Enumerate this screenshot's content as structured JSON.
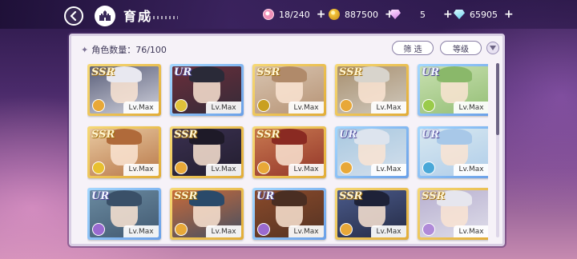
{
  "header": {
    "title": "育成",
    "resources": [
      {
        "icon": "candy-icon",
        "value": "18/240"
      },
      {
        "icon": "coin-icon",
        "value": "887500"
      },
      {
        "icon": "pink-gem-icon",
        "value": "5"
      },
      {
        "icon": "blue-gem-icon",
        "value": "65905"
      }
    ],
    "plus": "+"
  },
  "panel": {
    "count_label": "角色数量：76/100",
    "filter_button": "筛 选",
    "level_button": "等级"
  },
  "cards": [
    {
      "rarity": "SSR",
      "level": "Lv.Max",
      "hair": "#e8e8f0",
      "bg": "#5a5f7a",
      "attr": "#e8a838"
    },
    {
      "rarity": "UR",
      "level": "Lv.Max",
      "hair": "#2a2a38",
      "bg": "#6a2e3a",
      "attr": "#e0c23a"
    },
    {
      "rarity": "SSR",
      "level": "Lv.Max",
      "hair": "#b08a6a",
      "bg": "#d8c4b0",
      "attr": "#c9a020"
    },
    {
      "rarity": "SSR",
      "level": "Lv.Max",
      "hair": "#d8d4cc",
      "bg": "#a89070",
      "attr": "#e8a838"
    },
    {
      "rarity": "UR",
      "level": "Lv.Max",
      "hair": "#8ab86a",
      "bg": "#c8e0b0",
      "attr": "#9acb4a"
    },
    {
      "rarity": "SSR",
      "level": "Lv.Max",
      "hair": "#b06a3a",
      "bg": "#e8c8a0",
      "attr": "#e8c030"
    },
    {
      "rarity": "SSR",
      "level": "Lv.Max",
      "hair": "#1e1a28",
      "bg": "#3a3050",
      "attr": "#e8a838"
    },
    {
      "rarity": "SSR",
      "level": "Lv.Max",
      "hair": "#8a2a22",
      "bg": "#c87850",
      "attr": "#e8a838"
    },
    {
      "rarity": "UR",
      "level": "Lv.Max",
      "hair": "#dde4ee",
      "bg": "#a8c8e0",
      "attr": "#e8a838"
    },
    {
      "rarity": "UR",
      "level": "Lv.Max",
      "hair": "#a8c8e8",
      "bg": "#d8e8f0",
      "attr": "#4aa8d8"
    },
    {
      "rarity": "UR",
      "level": "Lv.Max",
      "hair": "#3a5068",
      "bg": "#6a8aa0",
      "attr": "#9a6ad0"
    },
    {
      "rarity": "SSR",
      "level": "Lv.Max",
      "hair": "#2a4a6a",
      "bg": "#c86a3a",
      "attr": "#e8a838"
    },
    {
      "rarity": "UR",
      "level": "Lv.Max",
      "hair": "#4a2e22",
      "bg": "#8a4a2a",
      "attr": "#9a6ad0"
    },
    {
      "rarity": "SSR",
      "level": "Lv.Max",
      "hair": "#1e2238",
      "bg": "#4a5a8a",
      "attr": "#e8a838"
    },
    {
      "rarity": "SSR",
      "level": "Lv.Max",
      "hair": "#e6e6ee",
      "bg": "#b8b0d0",
      "attr": "#b08ad8"
    }
  ],
  "colors": {
    "panel_bg": "#f6f2f8",
    "ssr_frame": "#e2ad38",
    "ur_frame": "#6aa0e8"
  }
}
